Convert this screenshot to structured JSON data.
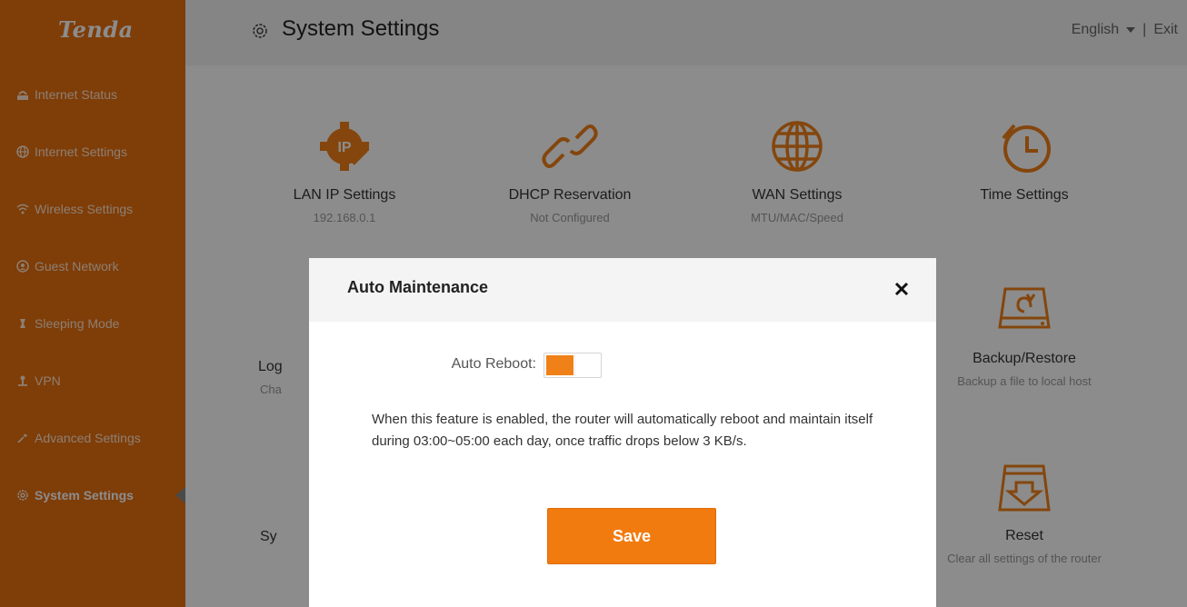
{
  "sidebar": {
    "logo": "Tenda",
    "items": [
      {
        "label": "Internet Status",
        "icon": "network-status-icon"
      },
      {
        "label": "Internet Settings",
        "icon": "globe-icon"
      },
      {
        "label": "Wireless Settings",
        "icon": "wifi-icon"
      },
      {
        "label": "Guest Network",
        "icon": "guest-icon"
      },
      {
        "label": "Sleeping Mode",
        "icon": "sleep-icon"
      },
      {
        "label": "VPN",
        "icon": "vpn-icon"
      },
      {
        "label": "Advanced Settings",
        "icon": "tools-icon"
      },
      {
        "label": "System Settings",
        "icon": "gear-icon",
        "active": true
      }
    ]
  },
  "header": {
    "title": "System Settings",
    "language": "English",
    "separator": "|",
    "exit": "Exit"
  },
  "tiles": [
    {
      "title": "LAN IP Settings",
      "subtitle": "192.168.0.1",
      "icon": "ip-gear-icon"
    },
    {
      "title": "DHCP Reservation",
      "subtitle": "Not Configured",
      "icon": "link-icon"
    },
    {
      "title": "WAN Settings",
      "subtitle": "MTU/MAC/Speed",
      "icon": "globe-icon"
    },
    {
      "title": "Time Settings",
      "subtitle": "",
      "icon": "clock-icon"
    },
    {
      "title": "Backup/Restore",
      "subtitle": "Backup a file to local host",
      "icon": "backup-drive-icon"
    },
    {
      "title": "Reset",
      "subtitle": "Clear all settings of the router",
      "icon": "reset-drive-icon"
    },
    {
      "title": "Log",
      "subtitle": "Cha",
      "icon": ""
    },
    {
      "title": "Sy",
      "subtitle": "",
      "icon": ""
    }
  ],
  "modal": {
    "title": "Auto Maintenance",
    "reboot_label": "Auto Reboot:",
    "reboot_enabled": true,
    "description": "When this feature is enabled, the router will automatically reboot and maintain itself during 03:00~05:00 each day, once traffic drops below 3 KB/s.",
    "save_label": "Save"
  },
  "colors": {
    "brand": "#e8700f",
    "button": "#f27b0f"
  }
}
